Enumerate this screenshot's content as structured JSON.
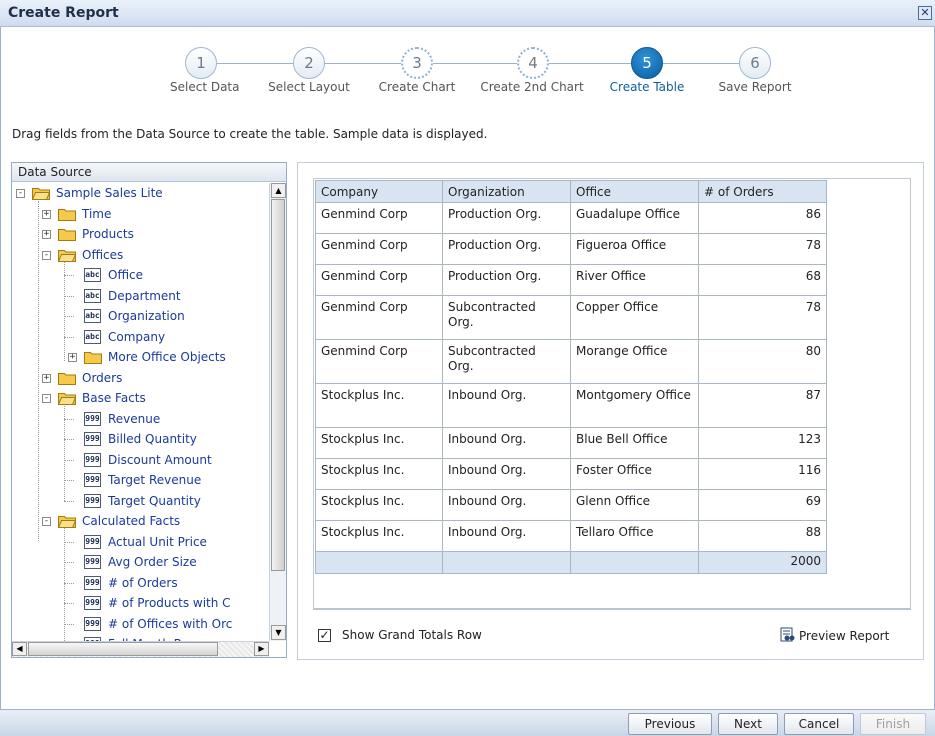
{
  "window": {
    "title": "Create Report"
  },
  "wizard": {
    "steps": [
      {
        "num": "1",
        "label": "Select Data"
      },
      {
        "num": "2",
        "label": "Select Layout"
      },
      {
        "num": "3",
        "label": "Create Chart"
      },
      {
        "num": "4",
        "label": "Create 2nd Chart"
      },
      {
        "num": "5",
        "label": "Create Table"
      },
      {
        "num": "6",
        "label": "Save Report"
      }
    ],
    "active_step": "5"
  },
  "instructions": "Drag fields from the Data Source to create the table. Sample data is displayed.",
  "data_source": {
    "header": "Data Source",
    "tree": [
      {
        "label": "Sample Sales Lite",
        "icon": "folder-open-icon",
        "expander": "−"
      },
      {
        "label": "Time",
        "icon": "folder-icon",
        "expander": "+"
      },
      {
        "label": "Products",
        "icon": "folder-icon",
        "expander": "+"
      },
      {
        "label": "Offices",
        "icon": "folder-open-icon",
        "expander": "−"
      },
      {
        "label": "Office",
        "icon": "text-field-icon",
        "glyph": "abc"
      },
      {
        "label": "Department",
        "icon": "text-field-icon",
        "glyph": "abc"
      },
      {
        "label": "Organization",
        "icon": "text-field-icon",
        "glyph": "abc"
      },
      {
        "label": "Company",
        "icon": "text-field-icon",
        "glyph": "abc"
      },
      {
        "label": "More Office Objects",
        "icon": "folder-icon",
        "expander": "+"
      },
      {
        "label": "Orders",
        "icon": "folder-icon",
        "expander": "+"
      },
      {
        "label": "Base Facts",
        "icon": "folder-open-icon",
        "expander": "−"
      },
      {
        "label": "Revenue",
        "icon": "numeric-field-icon",
        "glyph": "999"
      },
      {
        "label": "Billed Quantity",
        "icon": "numeric-field-icon",
        "glyph": "999"
      },
      {
        "label": "Discount Amount",
        "icon": "numeric-field-icon",
        "glyph": "999"
      },
      {
        "label": "Target Revenue",
        "icon": "numeric-field-icon",
        "glyph": "999"
      },
      {
        "label": "Target Quantity",
        "icon": "numeric-field-icon",
        "glyph": "999"
      },
      {
        "label": "Calculated Facts",
        "icon": "folder-open-icon",
        "expander": "−"
      },
      {
        "label": "Actual Unit Price",
        "icon": "numeric-field-icon",
        "glyph": "999"
      },
      {
        "label": "Avg Order Size",
        "icon": "numeric-field-icon",
        "glyph": "999"
      },
      {
        "label": "# of Orders",
        "icon": "numeric-field-icon",
        "glyph": "999"
      },
      {
        "label": "# of Products with C",
        "icon": "numeric-field-icon",
        "glyph": "999"
      },
      {
        "label": "# of Offices with Orc",
        "icon": "numeric-field-icon",
        "glyph": "999"
      },
      {
        "label": "Full Month Revenue",
        "icon": "numeric-field-icon",
        "glyph": "999"
      }
    ]
  },
  "table": {
    "columns": [
      "Company",
      "Organization",
      "Office",
      "# of Orders"
    ],
    "rows": [
      [
        "Genmind Corp",
        "Production Org.",
        "Guadalupe Office",
        "86"
      ],
      [
        "Genmind Corp",
        "Production Org.",
        "Figueroa Office",
        "78"
      ],
      [
        "Genmind Corp",
        "Production Org.",
        "River Office",
        "68"
      ],
      [
        "Genmind Corp",
        "Subcontracted Org.",
        "Copper Office",
        "78"
      ],
      [
        "Genmind Corp",
        "Subcontracted Org.",
        "Morange Office",
        "80"
      ],
      [
        "Stockplus Inc.",
        "Inbound Org.",
        "Montgomery Office",
        "87"
      ],
      [
        "Stockplus Inc.",
        "Inbound Org.",
        "Blue Bell Office",
        "123"
      ],
      [
        "Stockplus Inc.",
        "Inbound Org.",
        "Foster Office",
        "116"
      ],
      [
        "Stockplus Inc.",
        "Inbound Org.",
        "Glenn Office",
        "69"
      ],
      [
        "Stockplus Inc.",
        "Inbound Org.",
        "Tellaro Office",
        "88"
      ]
    ],
    "grand_total": "2000"
  },
  "options": {
    "show_grand_totals_label": "Show Grand Totals Row",
    "show_grand_totals_checked": true
  },
  "preview_label": "Preview Report",
  "footer": {
    "previous": "Previous",
    "next": "Next",
    "cancel": "Cancel",
    "finish": "Finish"
  },
  "colors": {
    "accent": "#0a5d9e",
    "link": "#1a3a9c",
    "header_bg": "#d9e4f2"
  }
}
